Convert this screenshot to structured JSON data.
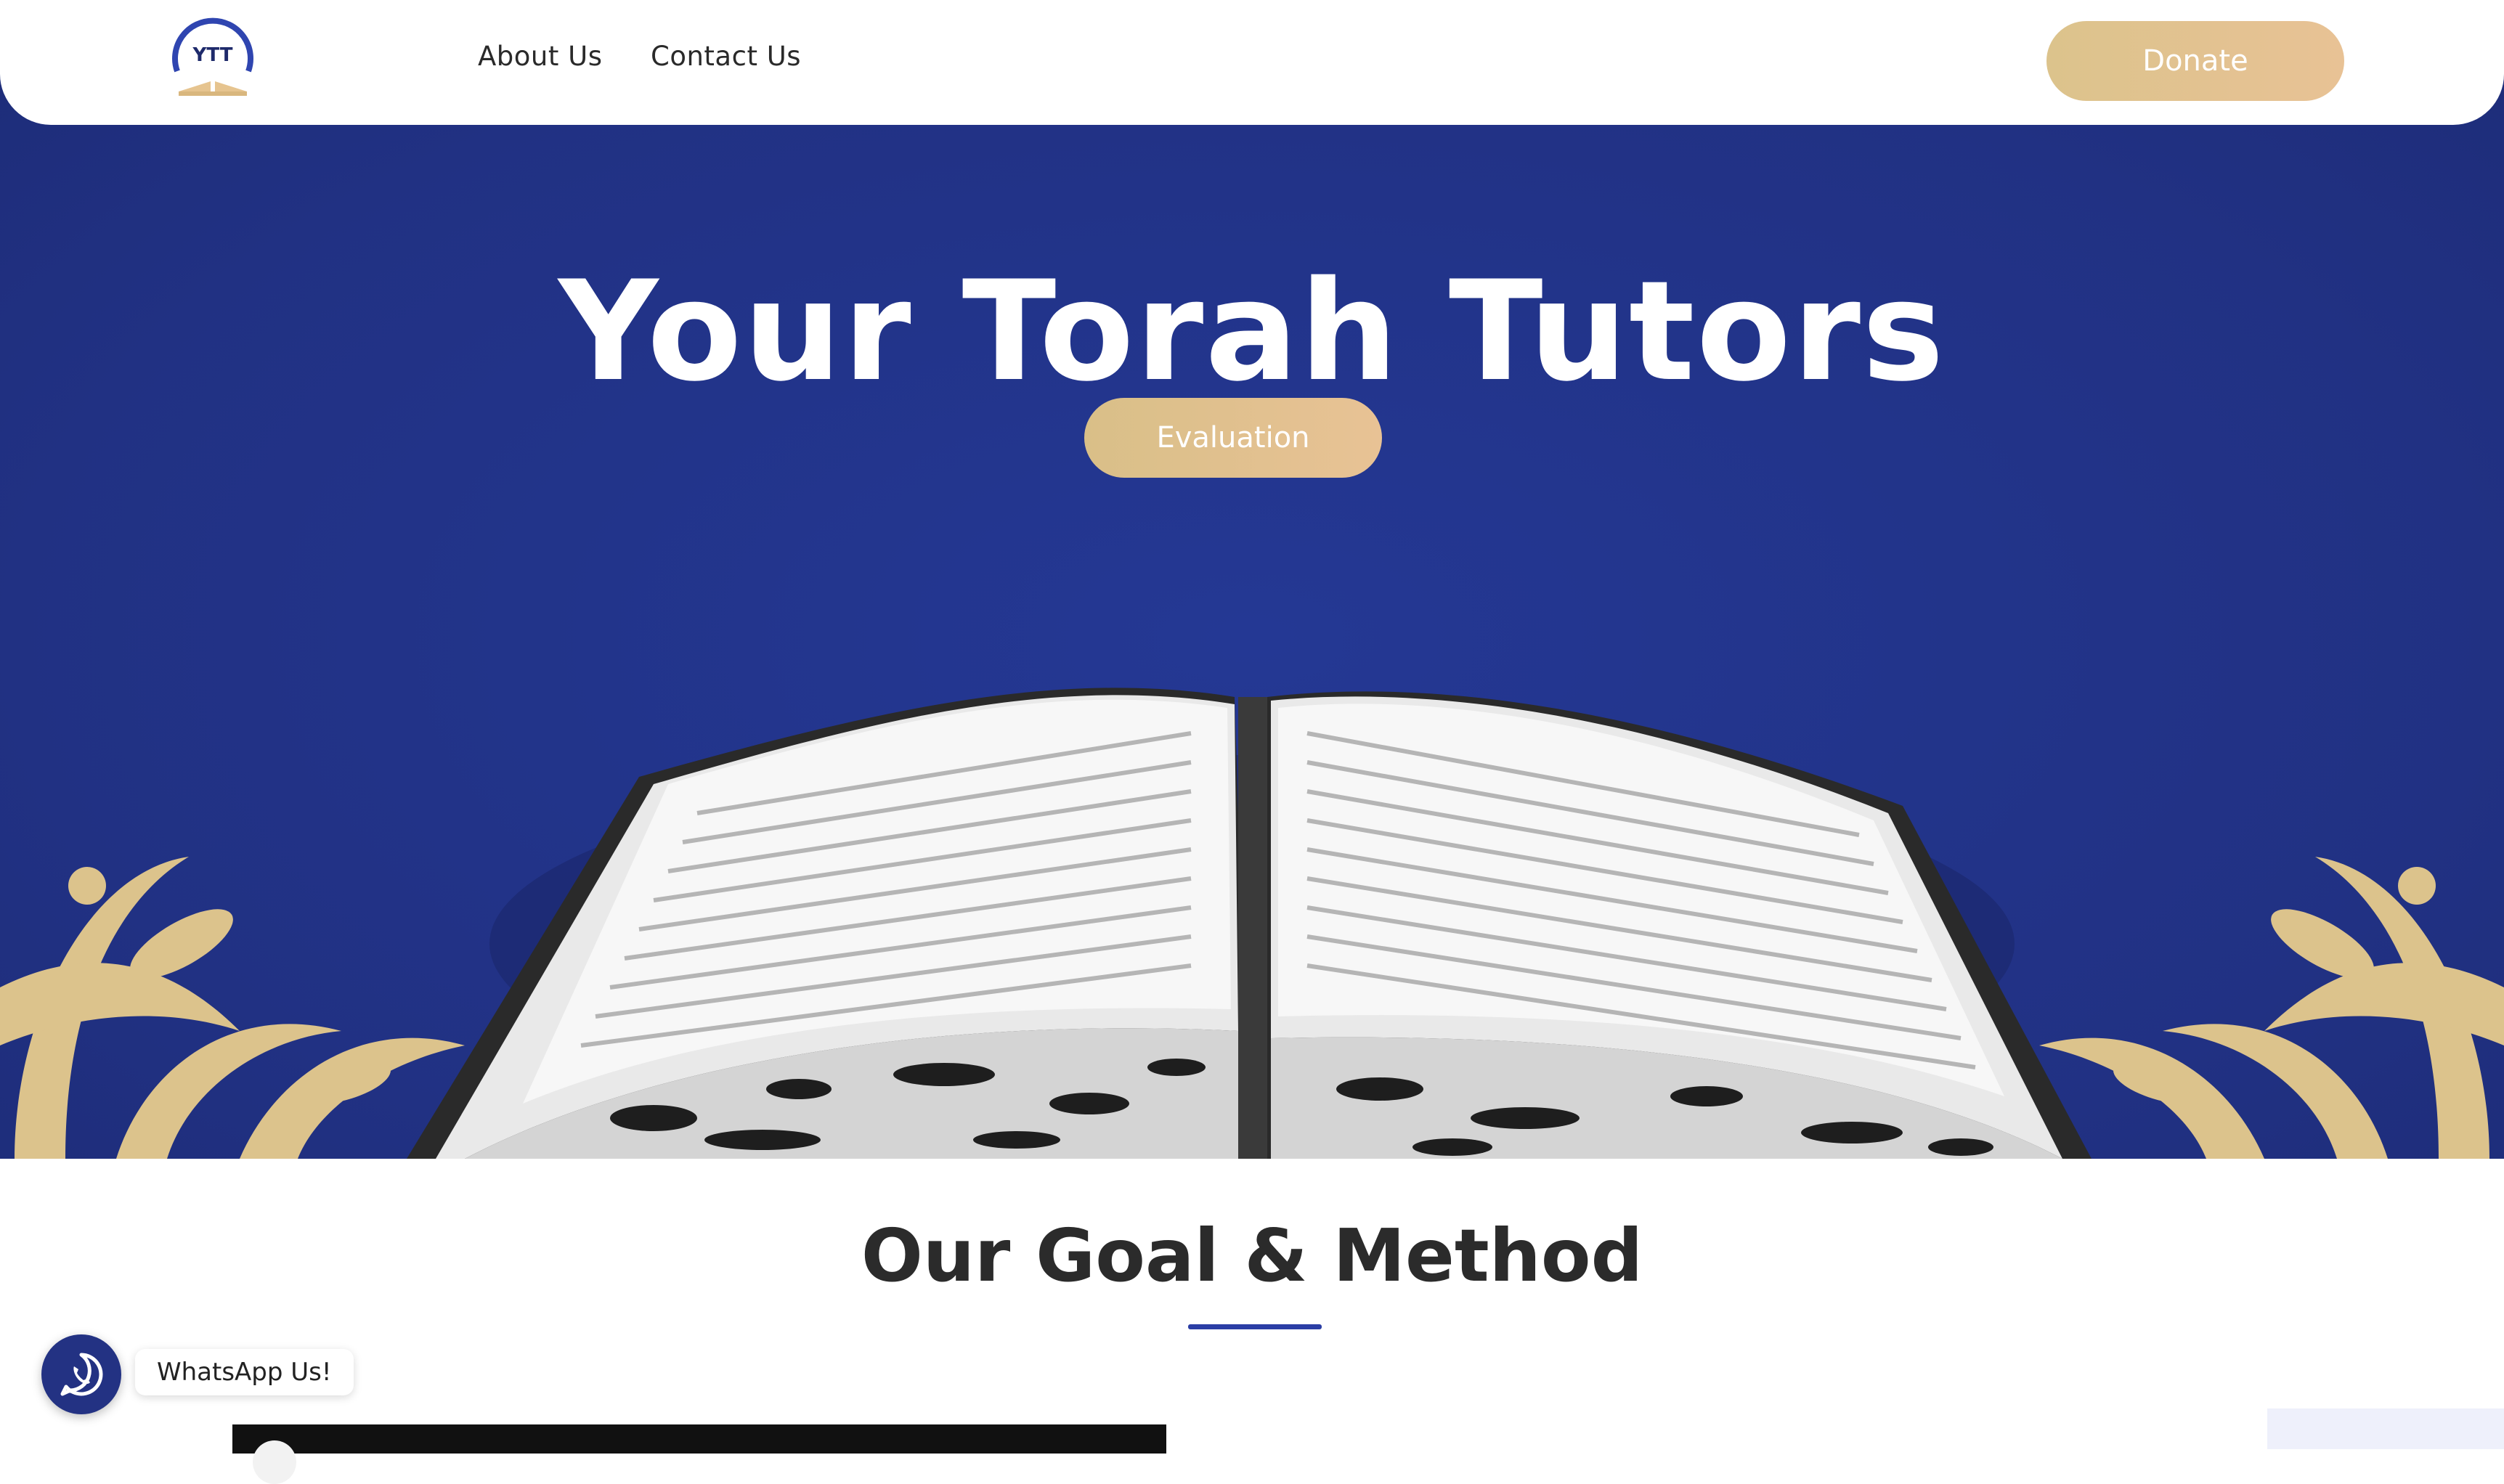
{
  "header": {
    "logo_text": "YTT",
    "nav": [
      {
        "label": "About Us"
      },
      {
        "label": "Contact Us"
      }
    ],
    "donate_label": "Donate"
  },
  "hero": {
    "title": "Your Torah Tutors",
    "cta_label": "Evaluation"
  },
  "goal": {
    "title": "Our Goal & Method"
  },
  "whatsapp": {
    "icon": "whatsapp-icon",
    "label": "WhatsApp Us!"
  },
  "colors": {
    "hero_blue": "#213183",
    "gold": "#dcc38c",
    "accent_blue": "#2b3ea5"
  }
}
